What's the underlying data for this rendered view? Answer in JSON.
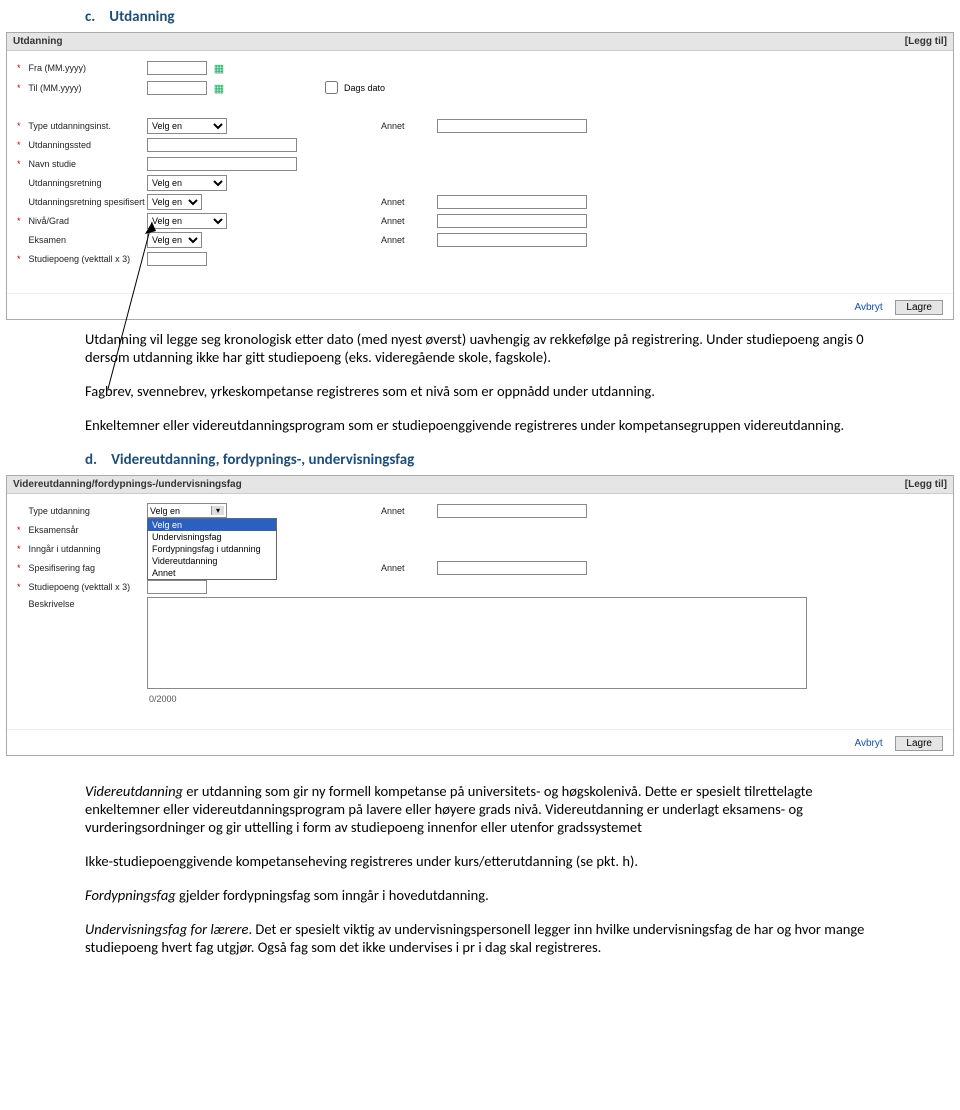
{
  "section_c": {
    "letter": "c.",
    "title": "Utdanning"
  },
  "panel1": {
    "title": "Utdanning",
    "legg_til": "[Legg til]",
    "labels": {
      "fra": "Fra (MM.yyyy)",
      "til": "Til (MM.yyyy)",
      "dags_dato": "Dags dato",
      "type_inst": "Type utdanningsinst.",
      "sted": "Utdanningssted",
      "navn_studie": "Navn studie",
      "retning": "Utdanningsretning",
      "retning_spes": "Utdanningsretning spesifisert",
      "niva": "Nivå/Grad",
      "eksamen": "Eksamen",
      "studiepoeng": "Studiepoeng (vekttall x 3)",
      "annet": "Annet"
    },
    "velg_en": "Velg en",
    "avbryt": "Avbryt",
    "lagre": "Lagre"
  },
  "text_c": {
    "p1": "Utdanning vil legge seg kronologisk etter dato (med nyest øverst) uavhengig av rekkefølge på registrering. Under studiepoeng angis 0 dersom utdanning ikke har gitt studiepoeng (eks. videregående skole, fagskole).",
    "p2": "Fagbrev, svennebrev, yrkeskompetanse registreres som et nivå som er oppnådd under utdanning.",
    "p3": "Enkeltemner eller videreutdanningsprogram som er studiepoenggivende registreres under kompetansegruppen videreutdanning."
  },
  "section_d": {
    "letter": "d.",
    "title": "Videreutdanning, fordypnings-, undervisningsfag"
  },
  "panel2": {
    "title": "Videreutdanning/fordypnings-/undervisningsfag",
    "legg_til": "[Legg til]",
    "labels": {
      "type_utd": "Type utdanning",
      "eksamensar": "Eksamensår",
      "inngar": "Inngår i utdanning",
      "spes_fag": "Spesifisering fag",
      "studiepoeng": "Studiepoeng (vekttall x 3)",
      "beskrivelse": "Beskrivelse",
      "annet": "Annet"
    },
    "velg_en": "Velg en",
    "dd_options": [
      "Velg en",
      "Undervisningsfag",
      "Fordypningsfag i utdanning",
      "Videreutdanning",
      "Annet"
    ],
    "counter": "0/2000",
    "avbryt": "Avbryt",
    "lagre": "Lagre"
  },
  "text_d": {
    "p1a": "Videreutdanning",
    "p1b": " er utdanning som gir ny formell kompetanse på universitets- og høgskolenivå. Dette er spesielt tilrettelagte enkeltemner eller videreutdanningsprogram på lavere eller høyere grads nivå. Videreutdanning er underlagt eksamens- og vurderingsordninger og gir uttelling i form av studiepoeng innenfor eller utenfor gradssystemet",
    "p2": "Ikke-studiepoenggivende kompetanseheving registreres under kurs/etterutdanning (se pkt. h).",
    "p3a": "Fordypningsfag",
    "p3b": " gjelder fordypningsfag som inngår i hovedutdanning.",
    "p4a": "Undervisningsfag for lærere",
    "p4b": ". Det er spesielt viktig av undervisningspersonell legger inn hvilke undervisningsfag de har og hvor mange studiepoeng hvert fag utgjør. Også fag som det ikke undervises i pr i dag skal registreres."
  }
}
